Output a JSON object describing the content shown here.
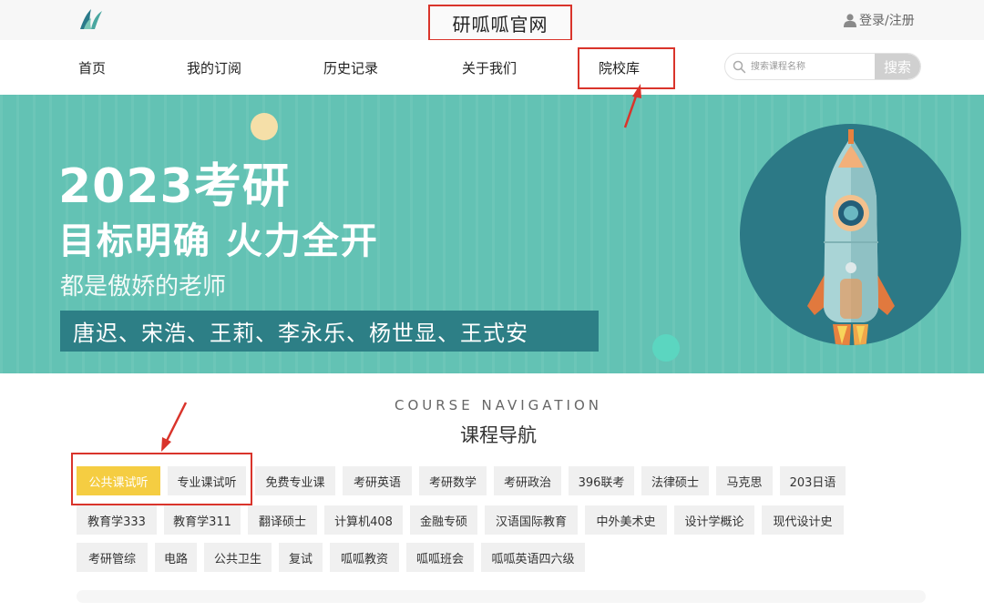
{
  "header": {
    "site_title": "研呱呱官网",
    "login_text": "登录/注册"
  },
  "nav": {
    "items": [
      {
        "label": "首页"
      },
      {
        "label": "我的订阅"
      },
      {
        "label": "历史记录"
      },
      {
        "label": "关于我们"
      },
      {
        "label": "院校库"
      }
    ]
  },
  "search": {
    "placeholder": "搜索课程名称",
    "button_label": "搜索"
  },
  "banner": {
    "headline": "2023考研",
    "slogan": "目标明确  火力全开",
    "subtitle": "都是傲娇的老师",
    "teachers": "唐迟、宋浩、王莉、李永乐、杨世显、王式安"
  },
  "course_nav": {
    "title_en": "COURSE NAVIGATION",
    "title_cn": "课程导航",
    "rows": [
      [
        {
          "label": "公共课试听",
          "active": true
        },
        {
          "label": "专业课试听"
        },
        {
          "label": "免费专业课"
        },
        {
          "label": "考研英语"
        },
        {
          "label": "考研数学"
        },
        {
          "label": "考研政治"
        },
        {
          "label": "396联考"
        },
        {
          "label": "法律硕士"
        },
        {
          "label": "马克思"
        },
        {
          "label": "203日语"
        }
      ],
      [
        {
          "label": "教育学333"
        },
        {
          "label": "教育学311"
        },
        {
          "label": "翻译硕士"
        },
        {
          "label": "计算机408"
        },
        {
          "label": "金融专硕"
        },
        {
          "label": "汉语国际教育"
        },
        {
          "label": "中外美术史"
        },
        {
          "label": "设计学概论"
        },
        {
          "label": "现代设计史"
        }
      ],
      [
        {
          "label": "考研管综"
        },
        {
          "label": "电路"
        },
        {
          "label": "公共卫生"
        },
        {
          "label": "复试"
        },
        {
          "label": "呱呱教资"
        },
        {
          "label": "呱呱班会"
        },
        {
          "label": "呱呱英语四六级"
        }
      ]
    ]
  },
  "colors": {
    "banner_bg": "#63c2b4",
    "teachers_bar": "#2d7f86",
    "active_tag": "#f5cd42",
    "annotation_red": "#d9342b"
  },
  "icons": {
    "logo": "logo-icon",
    "user": "user-icon",
    "search": "search-icon",
    "rocket": "rocket-illustration"
  }
}
